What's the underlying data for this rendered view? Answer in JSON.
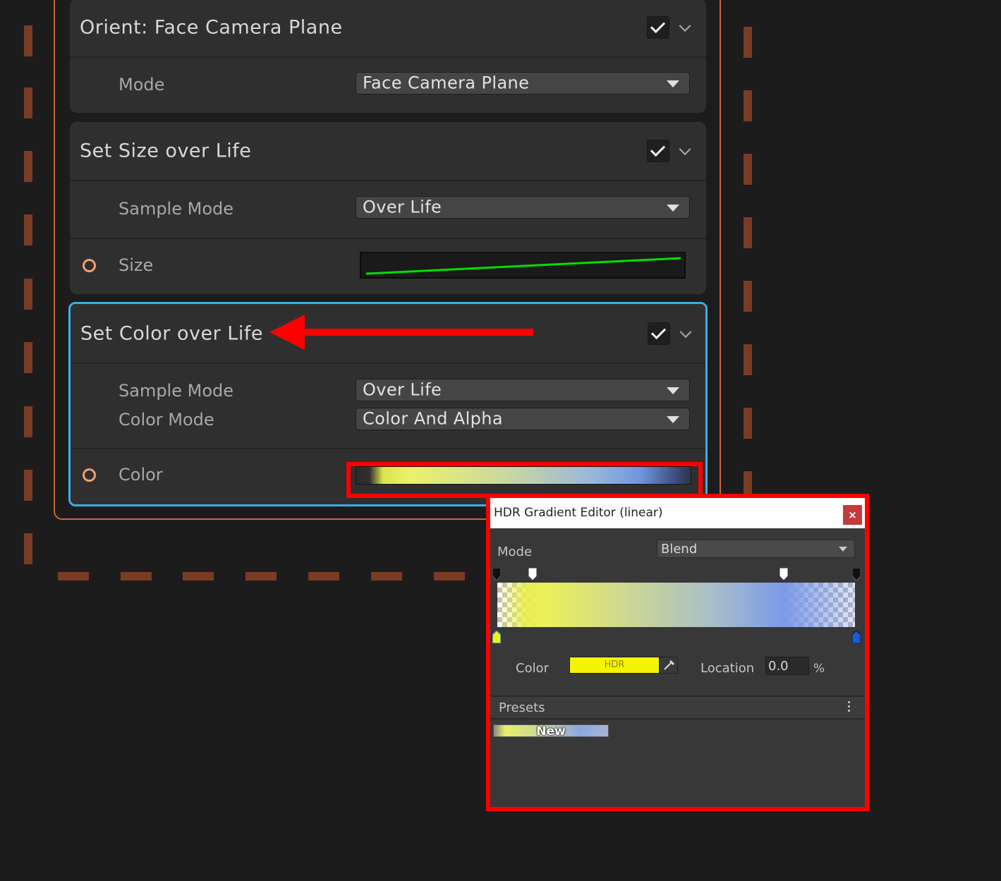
{
  "graph": {
    "orient_block": {
      "title": "Orient: Face Camera Plane",
      "enabled": true,
      "mode_label": "Mode",
      "mode_value": "Face Camera Plane"
    },
    "size_block": {
      "title": "Set Size over Life",
      "enabled": true,
      "sample_mode_label": "Sample Mode",
      "sample_mode_value": "Over Life",
      "size_label": "Size",
      "curve_color": "#00e000"
    },
    "color_block": {
      "title": "Set Color over Life",
      "enabled": true,
      "sample_mode_label": "Sample Mode",
      "sample_mode_value": "Over Life",
      "color_mode_label": "Color Mode",
      "color_mode_value": "Color And Alpha",
      "color_label": "Color"
    }
  },
  "annotations": {
    "highlight_color": "#ff0000",
    "selection_color": "#3aaee8",
    "context_outline_color": "#c8643c"
  },
  "gradient_editor": {
    "title": "HDR Gradient Editor (linear)",
    "close_label": "×",
    "mode_label": "Mode",
    "mode_value": "Blend",
    "color_label": "Color",
    "color_swatch_text": "HDR",
    "selected_key_color": "#f4f400",
    "location_label": "Location",
    "location_value": "0.0",
    "location_unit": "%",
    "presets_label": "Presets",
    "preset_name": "New"
  }
}
